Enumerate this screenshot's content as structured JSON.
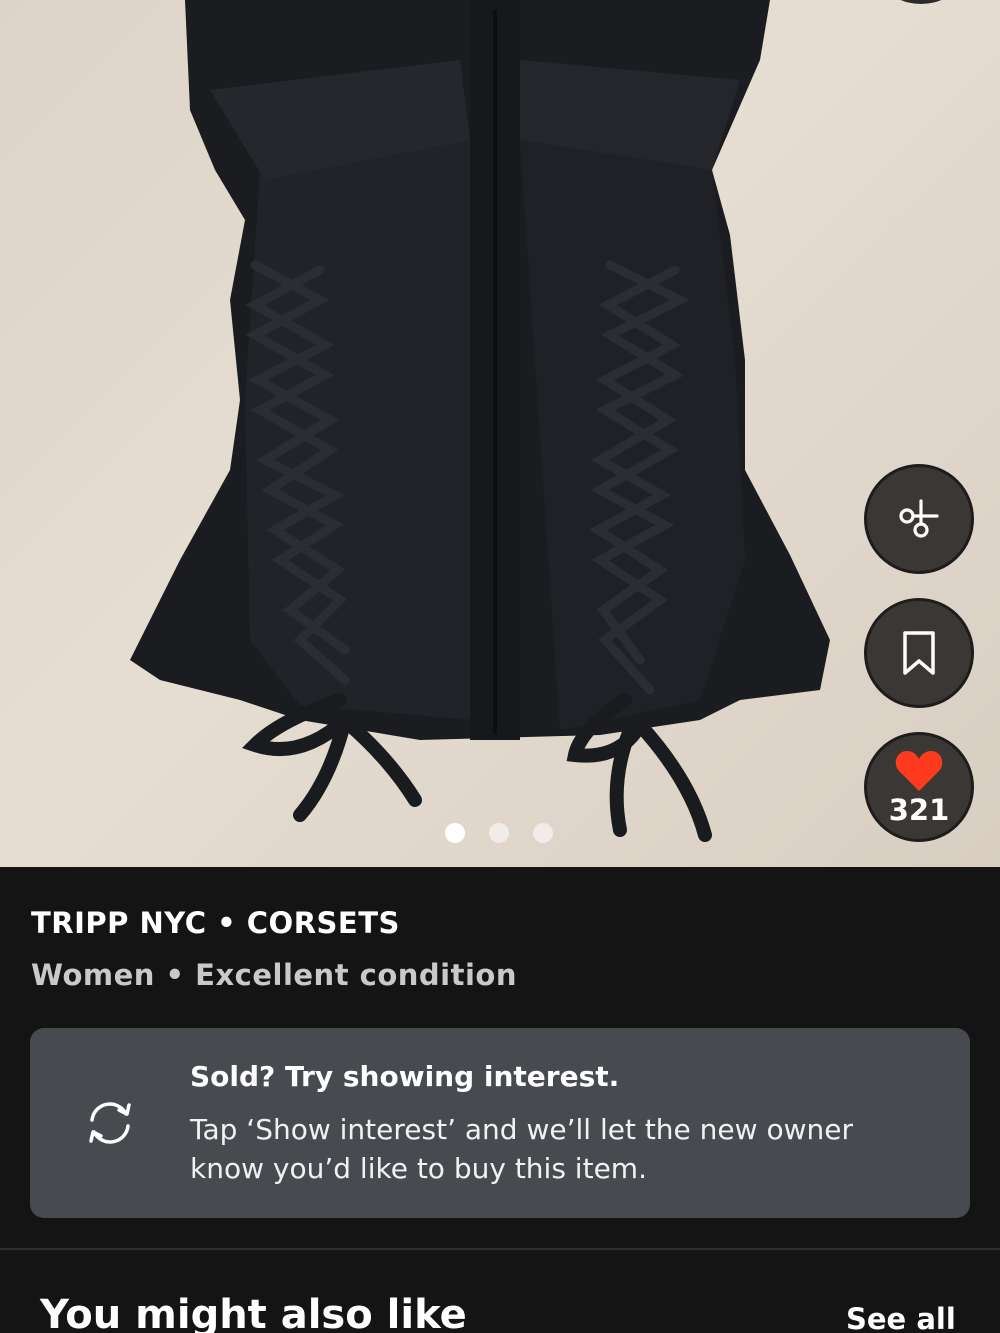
{
  "product": {
    "brand_line": "TRIPP NYC • CORSETS",
    "meta_line": "Women • Excellent condition",
    "image_subject": "black lace-up corset top",
    "carousel": {
      "total": 3,
      "active_index": 0
    }
  },
  "actions": {
    "offer_icon": "scissors-offer-icon",
    "save_icon": "bookmark-icon",
    "like_icon": "heart-icon",
    "like_count": "321"
  },
  "notice": {
    "icon": "refresh-icon",
    "title": "Sold? Try showing interest.",
    "body": "Tap ‘Show interest’ and we’ll let the new owner know you’d like to buy this item."
  },
  "recommendations": {
    "title": "You might also like",
    "see_all_label": "See all"
  },
  "colors": {
    "background": "#141414",
    "fab_background": "#3a3734",
    "like_red": "#ff3b1f",
    "notice_background": "#474b50",
    "secondary_text": "#c9c9c9"
  }
}
